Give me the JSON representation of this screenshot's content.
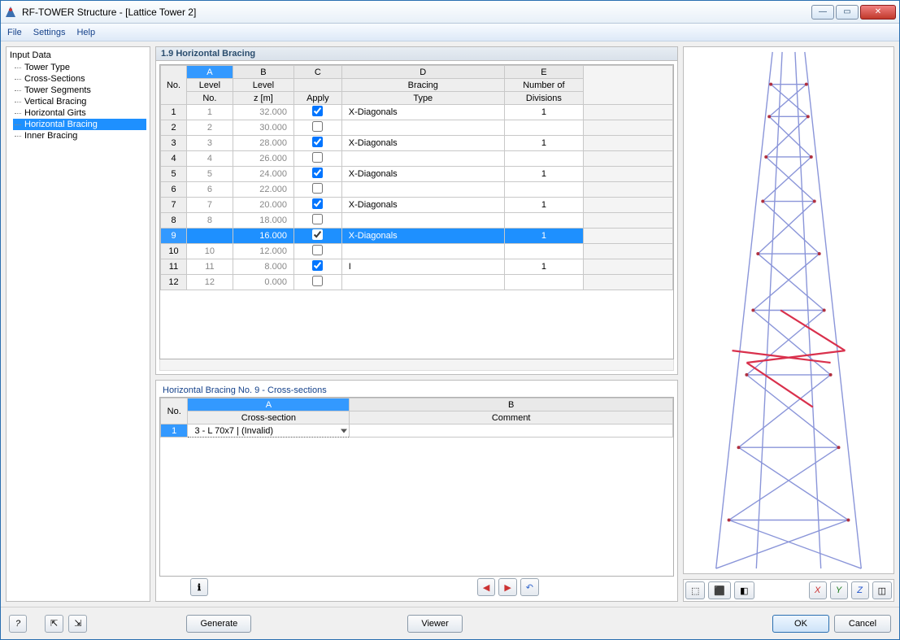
{
  "window": {
    "title": "RF-TOWER Structure - [Lattice Tower 2]"
  },
  "menu": {
    "file": "File",
    "settings": "Settings",
    "help": "Help"
  },
  "tree": {
    "header": "Input Data",
    "items": [
      "Tower Type",
      "Cross-Sections",
      "Tower Segments",
      "Vertical Bracing",
      "Horizontal Girts",
      "Horizontal Bracing",
      "Inner Bracing"
    ],
    "selectedIndex": 5
  },
  "section": {
    "title": "1.9 Horizontal Bracing",
    "cols": {
      "letters": [
        "A",
        "B",
        "C",
        "D",
        "E"
      ],
      "h1": [
        "Level",
        "Level",
        "",
        "Bracing",
        "Number of"
      ],
      "h2": [
        "No.",
        "z [m]",
        "Apply",
        "Type",
        "Divisions"
      ],
      "noLabel": "No."
    },
    "rows": [
      {
        "no": 1,
        "lvl": "1",
        "z": "32.000",
        "apply": true,
        "type": "X-Diagonals",
        "div": "1"
      },
      {
        "no": 2,
        "lvl": "2",
        "z": "30.000",
        "apply": false,
        "type": "",
        "div": ""
      },
      {
        "no": 3,
        "lvl": "3",
        "z": "28.000",
        "apply": true,
        "type": "X-Diagonals",
        "div": "1"
      },
      {
        "no": 4,
        "lvl": "4",
        "z": "26.000",
        "apply": false,
        "type": "",
        "div": ""
      },
      {
        "no": 5,
        "lvl": "5",
        "z": "24.000",
        "apply": true,
        "type": "X-Diagonals",
        "div": "1"
      },
      {
        "no": 6,
        "lvl": "6",
        "z": "22.000",
        "apply": false,
        "type": "",
        "div": ""
      },
      {
        "no": 7,
        "lvl": "7",
        "z": "20.000",
        "apply": true,
        "type": "X-Diagonals",
        "div": "1"
      },
      {
        "no": 8,
        "lvl": "8",
        "z": "18.000",
        "apply": false,
        "type": "",
        "div": ""
      },
      {
        "no": 9,
        "lvl": "",
        "z": "16.000",
        "apply": true,
        "type": "X-Diagonals",
        "div": "1",
        "selected": true
      },
      {
        "no": 10,
        "lvl": "10",
        "z": "12.000",
        "apply": false,
        "type": "",
        "div": ""
      },
      {
        "no": 11,
        "lvl": "11",
        "z": "8.000",
        "apply": true,
        "type": "I",
        "div": "1"
      },
      {
        "no": 12,
        "lvl": "12",
        "z": "0.000",
        "apply": false,
        "type": "",
        "div": ""
      }
    ]
  },
  "sub": {
    "title": "Horizontal Bracing No. 9  -  Cross-sections",
    "cols": {
      "letters": [
        "A",
        "B"
      ],
      "h": [
        "Cross-section",
        "Comment"
      ],
      "noLabel": "No."
    },
    "rows": [
      {
        "no": 1,
        "cs": "3 - L 70x7 | (Invalid)",
        "comment": "",
        "selected": true
      }
    ]
  },
  "buttons": {
    "generate": "Generate",
    "viewer": "Viewer",
    "ok": "OK",
    "cancel": "Cancel",
    "info": "ℹ",
    "prev": "◀",
    "next": "▶",
    "undo": "↶",
    "help": "?",
    "import": "⇱",
    "export": "⇲",
    "view": [
      "⬚",
      "⬛",
      "◧"
    ],
    "axis": [
      "X",
      "Y",
      "Z"
    ],
    "iso": "◫"
  }
}
